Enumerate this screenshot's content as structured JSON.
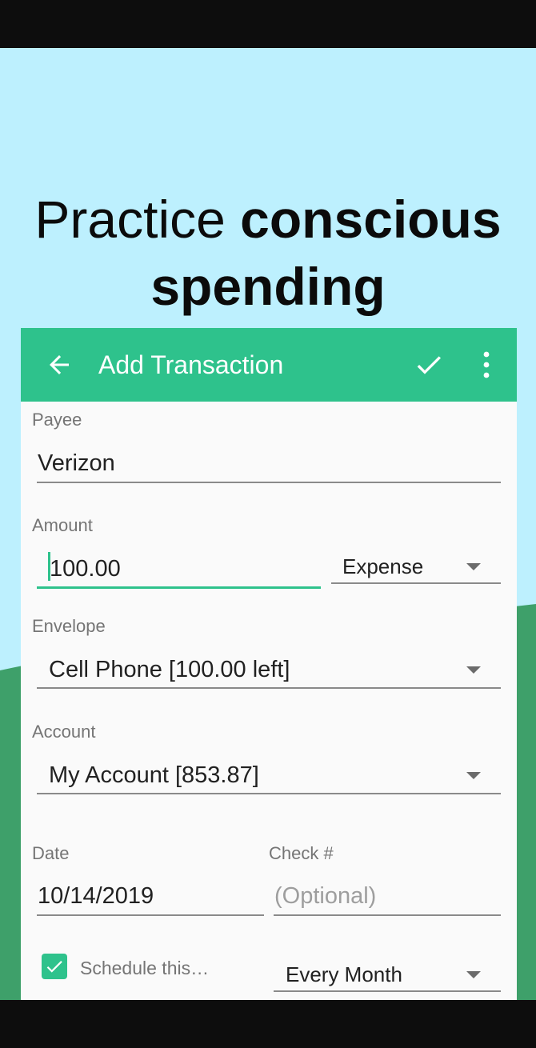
{
  "headline": {
    "line1_regular": "Practice ",
    "line1_bold": "conscious",
    "line2": "spending"
  },
  "appbar": {
    "title": "Add Transaction",
    "back_icon": "arrow-left-icon",
    "save_icon": "check-icon",
    "menu_icon": "more-vert-icon"
  },
  "form": {
    "payee": {
      "label": "Payee",
      "value": "Verizon"
    },
    "amount": {
      "label": "Amount",
      "value": "100.00",
      "type_value": "Expense"
    },
    "envelope": {
      "label": "Envelope",
      "value": "Cell Phone  [100.00 left]"
    },
    "account": {
      "label": "Account",
      "value": "My Account  [853.87]"
    },
    "date": {
      "label": "Date",
      "value": "10/14/2019"
    },
    "check": {
      "label": "Check #",
      "placeholder": "(Optional)"
    },
    "schedule": {
      "label": "Schedule this…",
      "checked": true,
      "frequency": "Every Month"
    }
  },
  "colors": {
    "accent": "#2ec28c",
    "sky": "#bdf0fe",
    "hill": "#3ea06a"
  }
}
